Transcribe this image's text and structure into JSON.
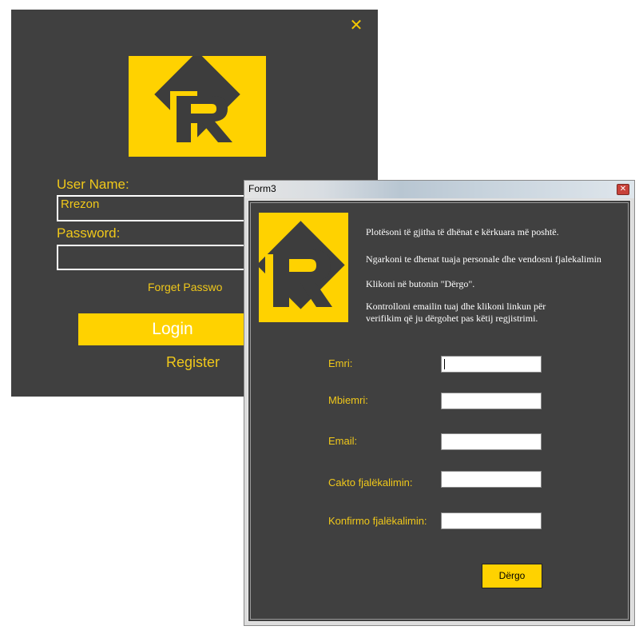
{
  "login": {
    "close_icon": "close-icon",
    "logo_icon": "r-logo-icon",
    "username_label": "User Name:",
    "username_value": "Rrezon",
    "password_label": "Password:",
    "password_value": "",
    "forget_password": "Forget Passwo",
    "login_button": "Login",
    "register_link": "Register",
    "accent_color": "#FFD200",
    "background_color": "#404040"
  },
  "form3": {
    "title": "Form3",
    "close_icon": "close-icon",
    "logo_icon": "r-logo-icon",
    "instructions": [
      "Plotësoni të gjitha të dhënat e kërkuara më poshtë.",
      "Ngarkoni te dhenat tuaja personale dhe vendosni fjalekalimin",
      "Klikoni në butonin \"Dërgo\".",
      "Kontrolloni emailin tuaj dhe klikoni linkun për",
      "verifikim që ju dërgohet pas këtij regjistrimi."
    ],
    "fields": [
      {
        "label": "Emri:",
        "value": ""
      },
      {
        "label": "Mbiemri:",
        "value": ""
      },
      {
        "label": "Email:",
        "value": ""
      },
      {
        "label": "Cakto fjalëkalimin:",
        "value": ""
      },
      {
        "label": "Konfirmo fjalëkalimin:",
        "value": ""
      }
    ],
    "submit_button": "Dërgo"
  }
}
